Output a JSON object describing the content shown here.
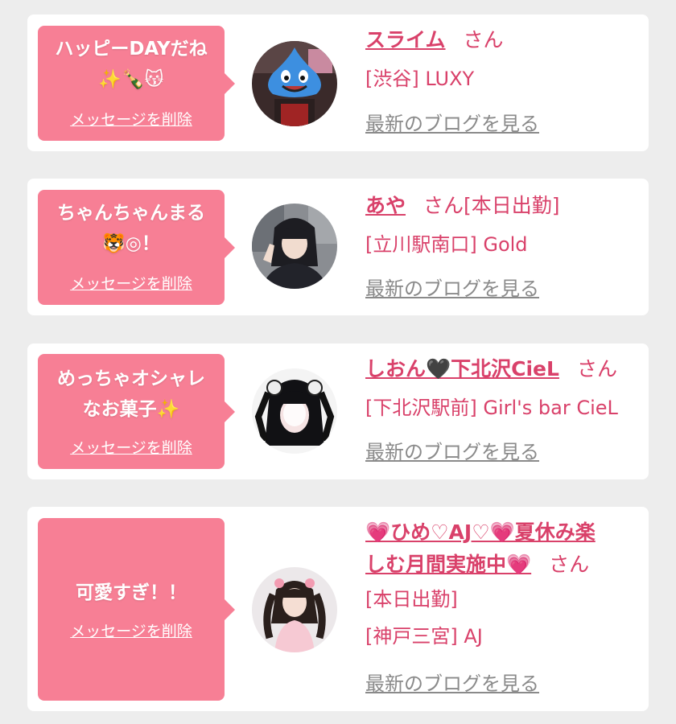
{
  "cards": [
    {
      "message": "ハッピーDAYだね\n✨🍾😽",
      "delete_label": "メッセージを削除",
      "name": "スライム",
      "honorific": "さん",
      "shop": "[渋谷] LUXY",
      "blog_link": "最新のブログを見る"
    },
    {
      "message": "ちゃんちゃんまる\n🐯◎！",
      "delete_label": "メッセージを削除",
      "name": "あや",
      "honorific": "さん[本日出勤]",
      "shop": "[立川駅南口] Gold",
      "blog_link": "最新のブログを見る"
    },
    {
      "message": "めっちゃオシャレ\nなお菓子✨",
      "delete_label": "メッセージを削除",
      "name": "しおん🖤下北沢CieL",
      "honorific": "さん",
      "shop": "[下北沢駅前] Girl's bar CieL",
      "blog_link": "最新のブログを見る"
    },
    {
      "message": "可愛すぎ！！",
      "delete_label": "メッセージを削除",
      "name_line1": "💗ひめ♡AJ♡💗夏休み楽",
      "name_line2": "しむ月間実施中💗",
      "honorific": "さん",
      "status": "[本日出勤]",
      "shop": "[神戸三宮] AJ",
      "blog_link": "最新のブログを見る"
    }
  ],
  "colors": {
    "bubble": "#f77f95",
    "name": "#d9416a",
    "blog_link": "#8a8a8a",
    "background": "#ededed"
  }
}
